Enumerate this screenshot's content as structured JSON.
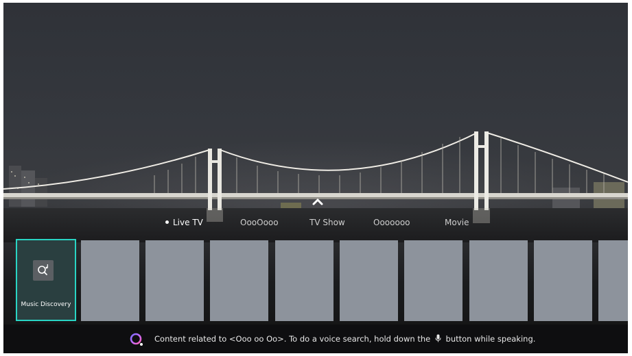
{
  "tabs": {
    "items": [
      {
        "label": "Live TV",
        "active": true
      },
      {
        "label": "OooOooo",
        "active": false
      },
      {
        "label": "TV Show",
        "active": false
      },
      {
        "label": "Ooooooo",
        "active": false
      },
      {
        "label": "Movie",
        "active": false
      }
    ]
  },
  "tiles": {
    "app": {
      "label": "Music Discovery",
      "icon": "music-search-icon"
    },
    "placeholder_count_visible": 9
  },
  "bottom_bar": {
    "text_before_mic": "Content related to <Ooo oo Oo>. To do a voice search, hold down the",
    "text_after_mic": "button while speaking.",
    "icon": "voice-assistant-icon",
    "mic_icon": "microphone-icon"
  },
  "colors": {
    "focus_border": "#29d5c4",
    "tile_placeholder": "#8d939c",
    "bottom_bar_bg": "#0e0e10"
  }
}
